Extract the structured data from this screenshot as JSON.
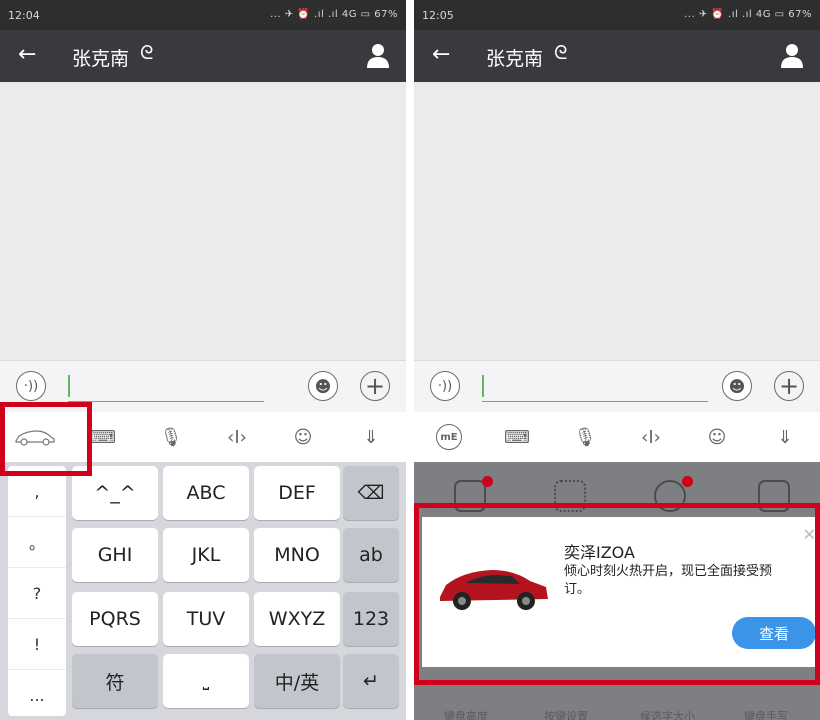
{
  "left": {
    "status_time": "12:04",
    "status_icons": "... ✈ ⏰ .ıl .ıl 4G ▭ 67%",
    "title": "张克南",
    "left_col": [
      ",",
      "。",
      "?",
      "!",
      "..."
    ],
    "keys": [
      "^_^",
      "ABC",
      "DEF",
      "GHI",
      "JKL",
      "MNO",
      "PQRS",
      "TUV",
      "WXYZ",
      "符",
      "中/英"
    ],
    "side_keys": [
      "⌫",
      "ab",
      "123",
      "↵"
    ]
  },
  "right": {
    "status_time": "12:05",
    "status_icons": "... ✈ ⏰ .ıl .ıl 4G ▭ 67%",
    "title": "张克南",
    "toolbar_first": "mE",
    "bottom_labels": [
      "键盘高度",
      "按键设置",
      "候选字大小",
      "键盘手写"
    ],
    "ad": {
      "brand": "奕泽IZOA",
      "desc": "倾心时刻火热开启，现已全面接受预订。",
      "button": "查看"
    }
  },
  "colors": {
    "accent": "#5cb85c",
    "highlight": "#d0021b",
    "ad_button": "#3a94e8"
  }
}
